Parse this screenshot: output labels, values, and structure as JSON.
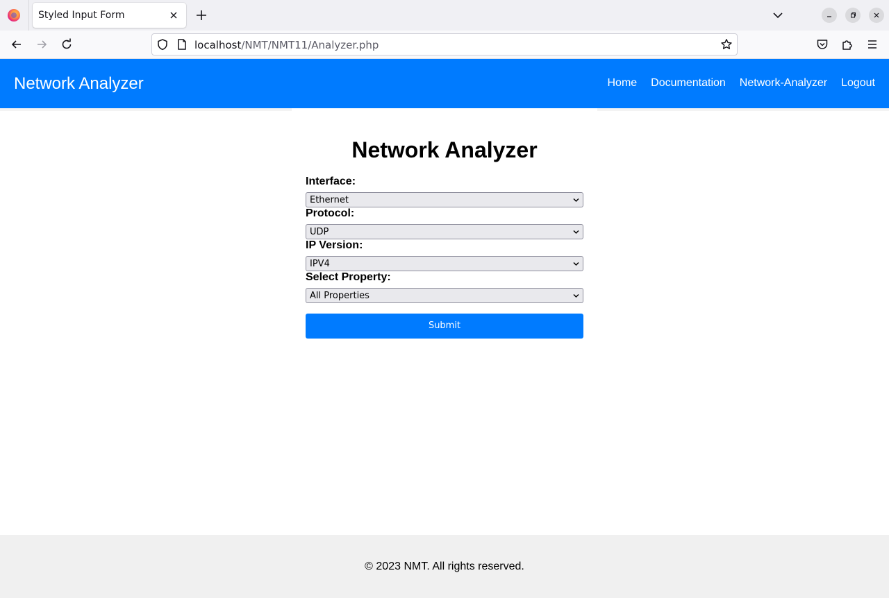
{
  "browser": {
    "tab_title": "Styled Input Form",
    "url_host": "localhost",
    "url_path": "/NMT/NMT11/Analyzer.php"
  },
  "header": {
    "brand": "Network Analyzer",
    "nav": [
      {
        "label": "Home"
      },
      {
        "label": "Documentation"
      },
      {
        "label": "Network-Analyzer"
      },
      {
        "label": "Logout"
      }
    ],
    "background_color": "#007bff"
  },
  "form": {
    "title": "Network Analyzer",
    "fields": [
      {
        "label": "Interface:",
        "value": "Ethernet"
      },
      {
        "label": "Protocol:",
        "value": "UDP"
      },
      {
        "label": "IP Version:",
        "value": "IPV4"
      },
      {
        "label": "Select Property:",
        "value": "All Properties"
      }
    ],
    "submit_label": "Submit",
    "accent_color": "#007bff"
  },
  "footer": {
    "text": "© 2023 NMT. All rights reserved."
  },
  "icons": {
    "browser": [
      "firefox-logo-icon",
      "close-icon",
      "plus-icon",
      "chevron-down-icon",
      "minimize-icon",
      "restore-icon",
      "close-window-icon"
    ],
    "navigation": [
      "back-arrow-icon",
      "forward-arrow-icon",
      "reload-icon",
      "shield-icon",
      "page-icon",
      "bookmark-star-icon",
      "pocket-icon",
      "extensions-icon",
      "hamburger-menu-icon"
    ]
  }
}
